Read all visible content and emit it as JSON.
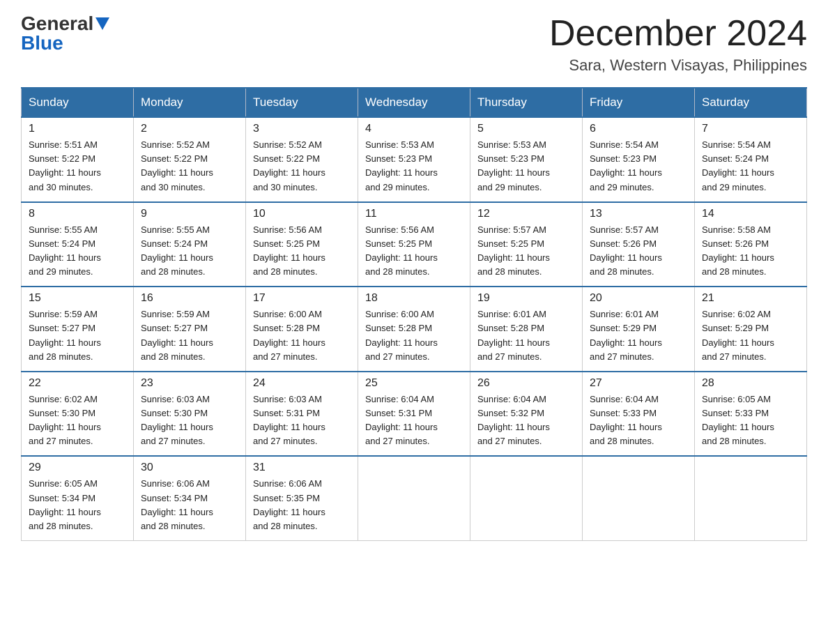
{
  "header": {
    "logo_general": "General",
    "logo_blue": "Blue",
    "month_year": "December 2024",
    "location": "Sara, Western Visayas, Philippines"
  },
  "days_of_week": [
    "Sunday",
    "Monday",
    "Tuesday",
    "Wednesday",
    "Thursday",
    "Friday",
    "Saturday"
  ],
  "weeks": [
    [
      {
        "day": "1",
        "sunrise": "5:51 AM",
        "sunset": "5:22 PM",
        "daylight": "11 hours and 30 minutes."
      },
      {
        "day": "2",
        "sunrise": "5:52 AM",
        "sunset": "5:22 PM",
        "daylight": "11 hours and 30 minutes."
      },
      {
        "day": "3",
        "sunrise": "5:52 AM",
        "sunset": "5:22 PM",
        "daylight": "11 hours and 30 minutes."
      },
      {
        "day": "4",
        "sunrise": "5:53 AM",
        "sunset": "5:23 PM",
        "daylight": "11 hours and 29 minutes."
      },
      {
        "day": "5",
        "sunrise": "5:53 AM",
        "sunset": "5:23 PM",
        "daylight": "11 hours and 29 minutes."
      },
      {
        "day": "6",
        "sunrise": "5:54 AM",
        "sunset": "5:23 PM",
        "daylight": "11 hours and 29 minutes."
      },
      {
        "day": "7",
        "sunrise": "5:54 AM",
        "sunset": "5:24 PM",
        "daylight": "11 hours and 29 minutes."
      }
    ],
    [
      {
        "day": "8",
        "sunrise": "5:55 AM",
        "sunset": "5:24 PM",
        "daylight": "11 hours and 29 minutes."
      },
      {
        "day": "9",
        "sunrise": "5:55 AM",
        "sunset": "5:24 PM",
        "daylight": "11 hours and 28 minutes."
      },
      {
        "day": "10",
        "sunrise": "5:56 AM",
        "sunset": "5:25 PM",
        "daylight": "11 hours and 28 minutes."
      },
      {
        "day": "11",
        "sunrise": "5:56 AM",
        "sunset": "5:25 PM",
        "daylight": "11 hours and 28 minutes."
      },
      {
        "day": "12",
        "sunrise": "5:57 AM",
        "sunset": "5:25 PM",
        "daylight": "11 hours and 28 minutes."
      },
      {
        "day": "13",
        "sunrise": "5:57 AM",
        "sunset": "5:26 PM",
        "daylight": "11 hours and 28 minutes."
      },
      {
        "day": "14",
        "sunrise": "5:58 AM",
        "sunset": "5:26 PM",
        "daylight": "11 hours and 28 minutes."
      }
    ],
    [
      {
        "day": "15",
        "sunrise": "5:59 AM",
        "sunset": "5:27 PM",
        "daylight": "11 hours and 28 minutes."
      },
      {
        "day": "16",
        "sunrise": "5:59 AM",
        "sunset": "5:27 PM",
        "daylight": "11 hours and 28 minutes."
      },
      {
        "day": "17",
        "sunrise": "6:00 AM",
        "sunset": "5:28 PM",
        "daylight": "11 hours and 27 minutes."
      },
      {
        "day": "18",
        "sunrise": "6:00 AM",
        "sunset": "5:28 PM",
        "daylight": "11 hours and 27 minutes."
      },
      {
        "day": "19",
        "sunrise": "6:01 AM",
        "sunset": "5:28 PM",
        "daylight": "11 hours and 27 minutes."
      },
      {
        "day": "20",
        "sunrise": "6:01 AM",
        "sunset": "5:29 PM",
        "daylight": "11 hours and 27 minutes."
      },
      {
        "day": "21",
        "sunrise": "6:02 AM",
        "sunset": "5:29 PM",
        "daylight": "11 hours and 27 minutes."
      }
    ],
    [
      {
        "day": "22",
        "sunrise": "6:02 AM",
        "sunset": "5:30 PM",
        "daylight": "11 hours and 27 minutes."
      },
      {
        "day": "23",
        "sunrise": "6:03 AM",
        "sunset": "5:30 PM",
        "daylight": "11 hours and 27 minutes."
      },
      {
        "day": "24",
        "sunrise": "6:03 AM",
        "sunset": "5:31 PM",
        "daylight": "11 hours and 27 minutes."
      },
      {
        "day": "25",
        "sunrise": "6:04 AM",
        "sunset": "5:31 PM",
        "daylight": "11 hours and 27 minutes."
      },
      {
        "day": "26",
        "sunrise": "6:04 AM",
        "sunset": "5:32 PM",
        "daylight": "11 hours and 27 minutes."
      },
      {
        "day": "27",
        "sunrise": "6:04 AM",
        "sunset": "5:33 PM",
        "daylight": "11 hours and 28 minutes."
      },
      {
        "day": "28",
        "sunrise": "6:05 AM",
        "sunset": "5:33 PM",
        "daylight": "11 hours and 28 minutes."
      }
    ],
    [
      {
        "day": "29",
        "sunrise": "6:05 AM",
        "sunset": "5:34 PM",
        "daylight": "11 hours and 28 minutes."
      },
      {
        "day": "30",
        "sunrise": "6:06 AM",
        "sunset": "5:34 PM",
        "daylight": "11 hours and 28 minutes."
      },
      {
        "day": "31",
        "sunrise": "6:06 AM",
        "sunset": "5:35 PM",
        "daylight": "11 hours and 28 minutes."
      },
      null,
      null,
      null,
      null
    ]
  ],
  "labels": {
    "sunrise": "Sunrise:",
    "sunset": "Sunset:",
    "daylight": "Daylight:"
  }
}
